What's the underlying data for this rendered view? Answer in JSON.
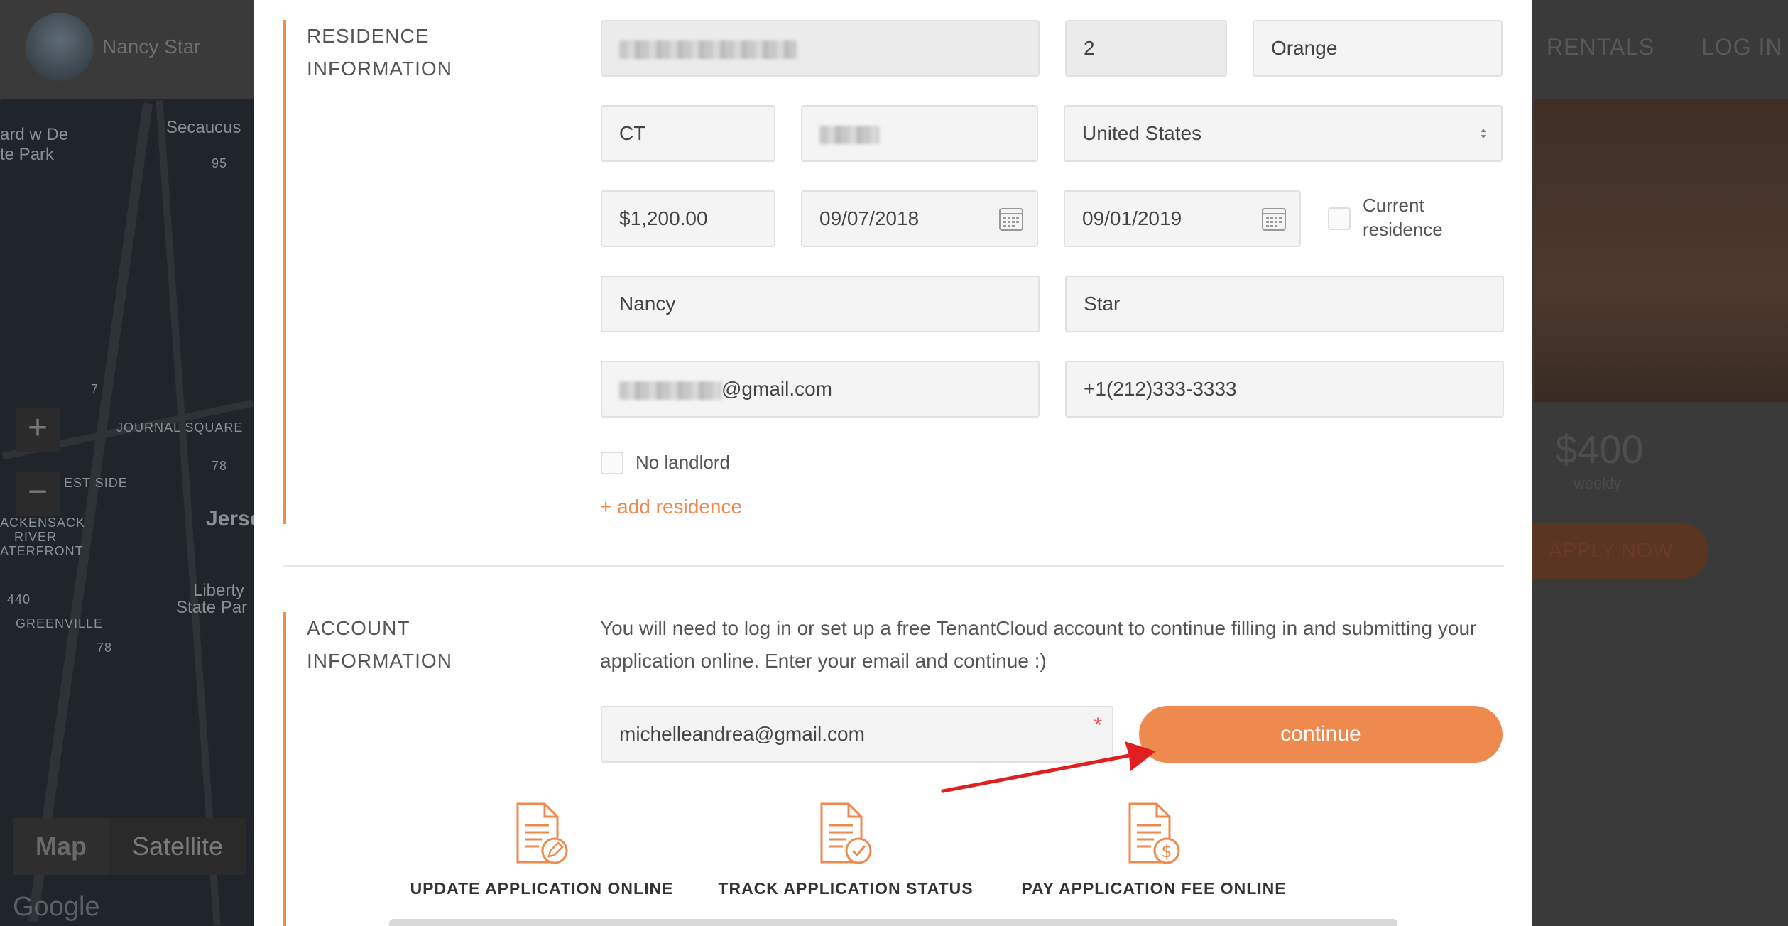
{
  "background": {
    "user_name": "Nancy Star",
    "nav": {
      "rentals": "RENTALS",
      "login": "LOG IN"
    },
    "listing": {
      "price": "$400",
      "period": "weekly",
      "apply_label": "APPLY NOW"
    },
    "map": {
      "labels": [
        "Secaucus",
        "ard w De",
        "te Park",
        "JOURNAL SQUARE",
        "EST SIDE",
        "Jerse",
        "ACKENSACK",
        "RIVER",
        "ATERFRONT",
        "Liberty",
        "State Par",
        "GREENVILLE"
      ],
      "route_badges": [
        "95",
        "7",
        "78",
        "440",
        "78"
      ],
      "zoom_in": "+",
      "zoom_out": "−",
      "type_map": "Map",
      "type_satellite": "Satellite",
      "google": "Google"
    }
  },
  "residence": {
    "section_title_line1": "RESIDENCE",
    "section_title_line2": "INFORMATION",
    "unit": "2",
    "city": "Orange",
    "state": "CT",
    "country": "United States",
    "rent": "$1,200.00",
    "move_in": "09/07/2018",
    "move_out": "09/01/2019",
    "current_residence_line1": "Current",
    "current_residence_line2": "residence",
    "landlord_first_name": "Nancy",
    "landlord_last_name": "Star",
    "landlord_email_suffix": "@gmail.com",
    "landlord_phone": "+1(212)333-3333",
    "no_landlord_label": "No landlord",
    "add_residence_label": "+ add residence"
  },
  "account": {
    "section_title_line1": "ACCOUNT",
    "section_title_line2": "INFORMATION",
    "description": "You will need to log in or set up a free TenantCloud account to continue filling in and submitting your application online. Enter your email and continue :)",
    "email": "michelleandrea@gmail.com",
    "required_mark": "*",
    "continue_label": "continue"
  },
  "features": [
    {
      "label": "UPDATE APPLICATION ONLINE",
      "icon": "document-edit-icon"
    },
    {
      "label": "TRACK APPLICATION STATUS",
      "icon": "document-check-icon"
    },
    {
      "label": "PAY APPLICATION FEE ONLINE",
      "icon": "document-dollar-icon"
    }
  ],
  "colors": {
    "accent": "#ef8a4f",
    "annotation_arrow": "#e02020"
  }
}
